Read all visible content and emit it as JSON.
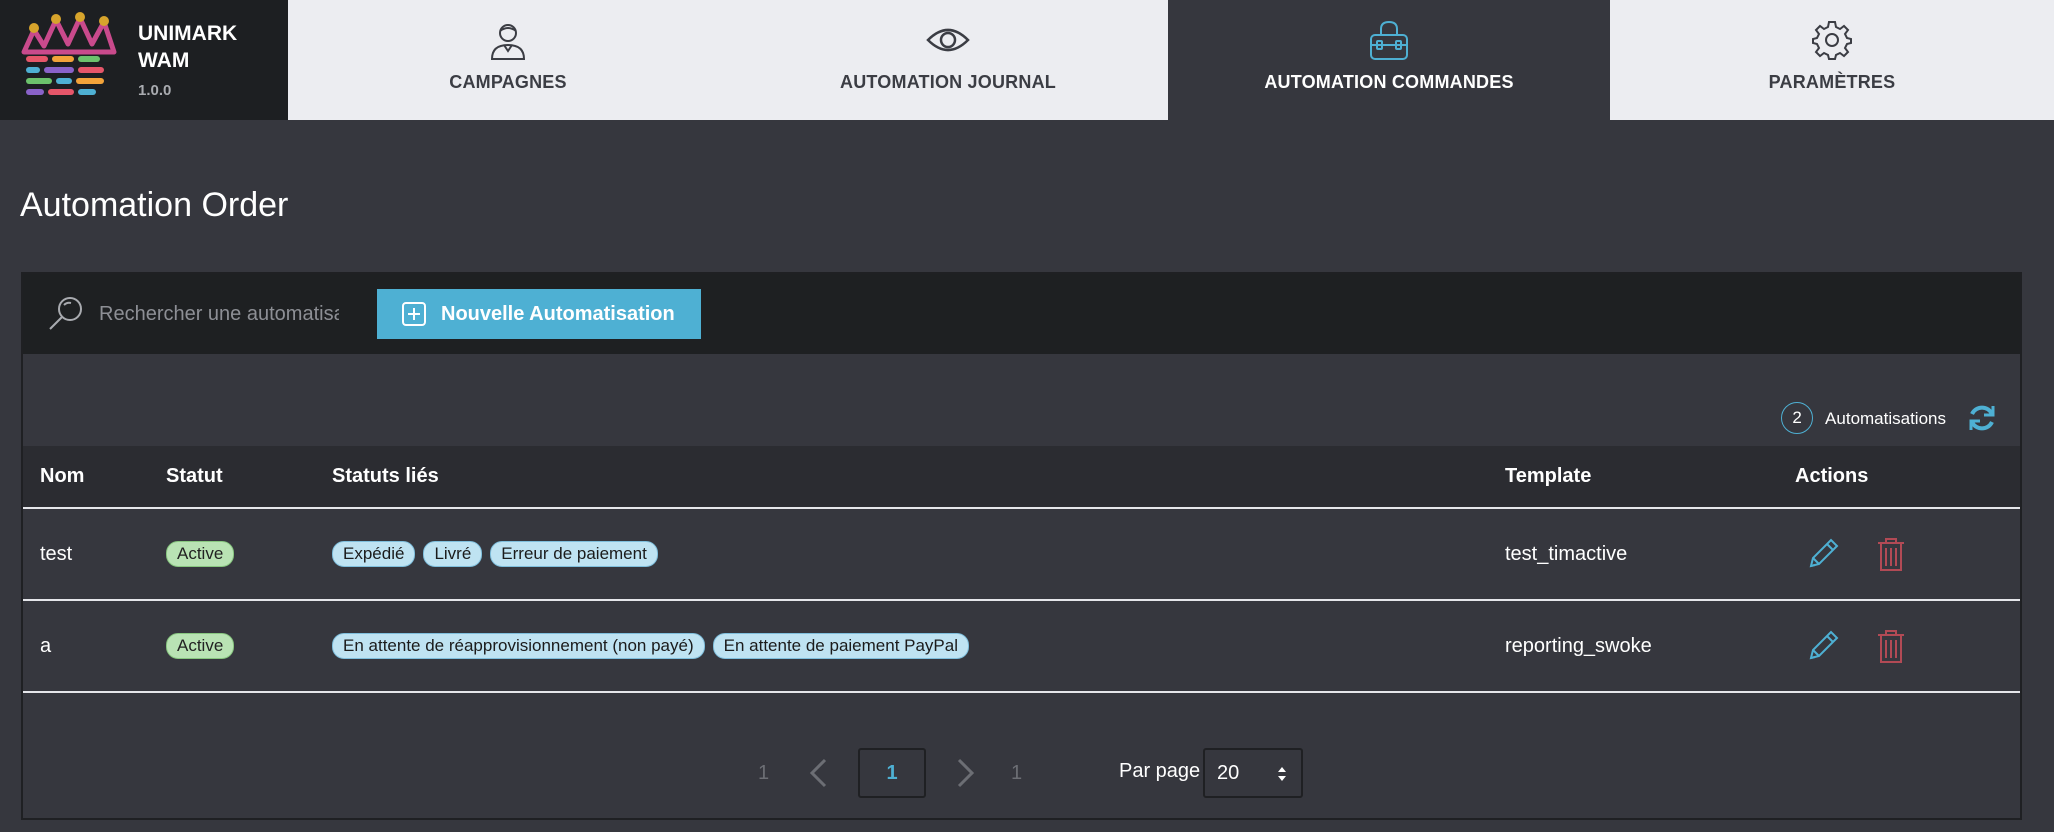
{
  "app": {
    "name_line1": "UNIMARK",
    "name_line2": "WAM",
    "version": "1.0.0"
  },
  "nav": {
    "tabs": [
      {
        "label": "CAMPAGNES",
        "icon": "user-icon",
        "active": false
      },
      {
        "label": "AUTOMATION JOURNAL",
        "icon": "eye-icon",
        "active": false
      },
      {
        "label": "AUTOMATION COMMANDES",
        "icon": "shopping-bag-icon",
        "active": true
      },
      {
        "label": "PARAMÈTRES",
        "icon": "gear-icon",
        "active": false
      }
    ]
  },
  "page": {
    "title": "Automation Order"
  },
  "toolbar": {
    "search_placeholder": "Rechercher une automatisation",
    "new_button_label": "Nouvelle Automatisation"
  },
  "summary": {
    "count": "2",
    "label": "Automatisations"
  },
  "table": {
    "headers": {
      "nom": "Nom",
      "statut": "Statut",
      "statuts_lies": "Statuts liés",
      "template": "Template",
      "actions": "Actions"
    },
    "rows": [
      {
        "nom": "test",
        "statut": "Active",
        "statuts_lies": [
          "Expédié",
          "Livré",
          "Erreur de paiement"
        ],
        "template": "test_timactive"
      },
      {
        "nom": "a",
        "statut": "Active",
        "statuts_lies": [
          "En attente de réapprovisionnement (non payé)",
          "En attente de paiement PayPal"
        ],
        "template": "reporting_swoke"
      }
    ]
  },
  "pagination": {
    "first": "1",
    "current": "1",
    "last": "1",
    "per_page_label": "Par page",
    "per_page_value": "20"
  },
  "colors": {
    "accent": "#4eb0d3",
    "danger": "#b24a55",
    "active_badge": "#b9e3b4",
    "status_badge": "#bfe3f2"
  }
}
